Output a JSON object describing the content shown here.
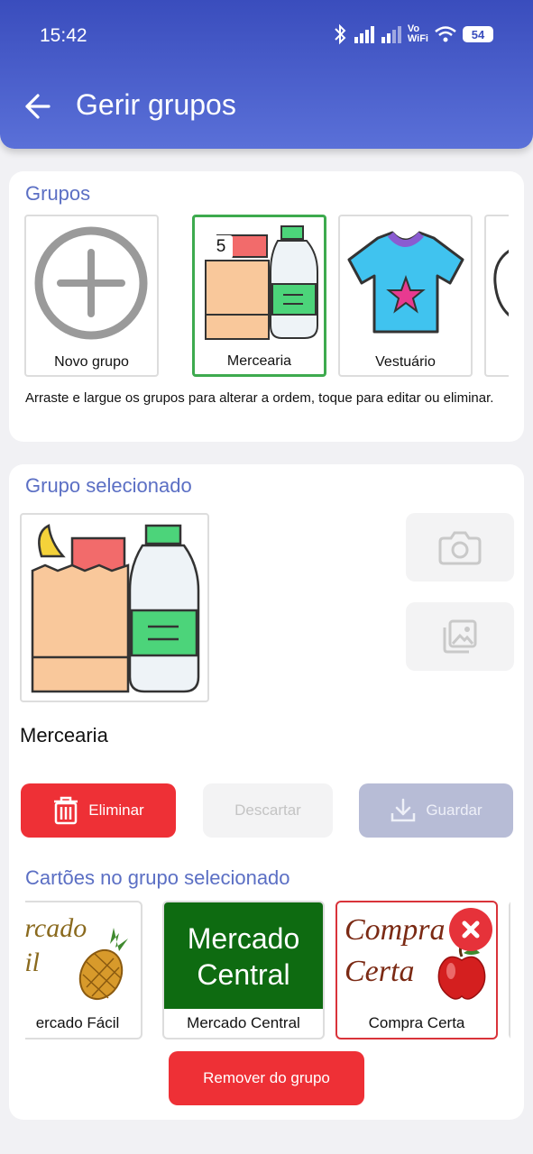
{
  "status_bar": {
    "time": "15:42",
    "wifi_label_top": "Vo",
    "wifi_label_bottom": "WiFi",
    "battery": "54"
  },
  "app_bar": {
    "title": "Gerir grupos",
    "back_icon": "arrow-left-icon"
  },
  "groups_section": {
    "title": "Grupos",
    "tiles": [
      {
        "label": "Novo grupo",
        "icon": "plus-circle-icon"
      },
      {
        "label": "Mercearia",
        "badge": "5",
        "selected": true
      },
      {
        "label": "Vestuário"
      }
    ],
    "hint": "Arraste e largue os grupos para alterar a ordem, toque para editar ou eliminar."
  },
  "selected_group": {
    "title": "Grupo selecionado",
    "name": "Mercearia",
    "camera_icon": "camera-icon",
    "gallery_icon": "gallery-icon",
    "delete_label": "Eliminar",
    "discard_label": "Descartar",
    "save_label": "Guardar"
  },
  "cards_section": {
    "title": "Cartões no grupo selecionado",
    "cards": [
      {
        "label": "ercado Fácil",
        "art_line1": "ercado",
        "art_line2": "cil"
      },
      {
        "label": "Mercado Central",
        "art_line1": "Mercado",
        "art_line2": "Central"
      },
      {
        "label": "Compra Certa",
        "art_line1": "Compra",
        "art_line2": "Certa"
      }
    ],
    "remove_label": "Remover do grupo"
  },
  "colors": {
    "accent": "#3a4dbd",
    "section_title": "#5b6fc4",
    "danger": "#ee3036",
    "selected_border": "#3daa4e"
  }
}
